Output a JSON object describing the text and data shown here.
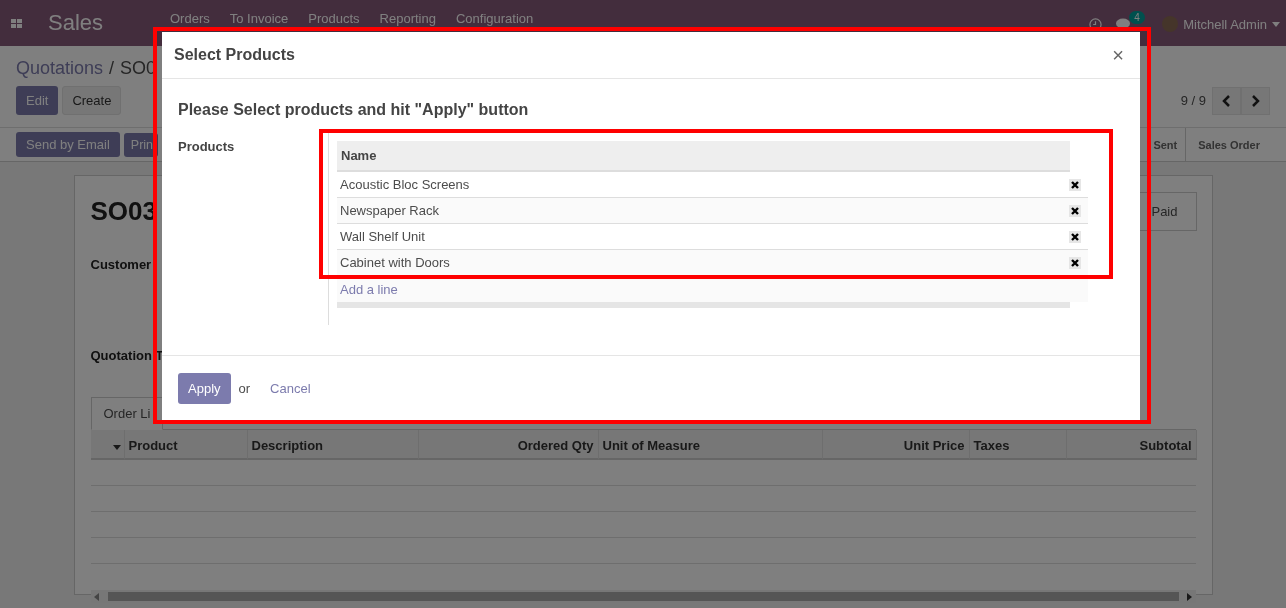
{
  "navbar": {
    "app_name": "Sales",
    "menu": [
      "Orders",
      "To Invoice",
      "Products",
      "Reporting",
      "Configuration"
    ],
    "messages_badge": "4",
    "user": "Mitchell Admin"
  },
  "breadcrumb": {
    "parent": "Quotations",
    "separator": "/",
    "current": "SO0"
  },
  "control_buttons": [
    {
      "label": "Edit",
      "kind": "primary"
    },
    {
      "label": "Create",
      "kind": "secondary"
    }
  ],
  "pager": "9 / 9",
  "action_buttons": [
    "Send by Email",
    "Prin"
  ],
  "status_steps": [
    "Sent",
    "Sales Order"
  ],
  "sheet": {
    "title": "SO03",
    "fields": [
      "Customer",
      "Quotation T"
    ],
    "smart_button": "Paid",
    "tab": "Order Li",
    "columns": [
      {
        "label": "Product",
        "numeric": false
      },
      {
        "label": "Description",
        "numeric": false
      },
      {
        "label": "Ordered Qty",
        "numeric": true
      },
      {
        "label": "Unit of Measure",
        "numeric": false
      },
      {
        "label": "Unit Price",
        "numeric": true
      },
      {
        "label": "Taxes",
        "numeric": false
      },
      {
        "label": "Subtotal",
        "numeric": true
      }
    ]
  },
  "dialog": {
    "title": "Select Products",
    "close": "×",
    "heading": "Please Select products and hit \"Apply\" button",
    "field_label": "Products",
    "column": "Name",
    "rows": [
      "Acoustic Bloc Screens",
      "Newspaper Rack",
      "Wall Shelf Unit",
      "Cabinet with Doors"
    ],
    "add_line": "Add a line",
    "apply": "Apply",
    "or": "or",
    "cancel": "Cancel"
  }
}
